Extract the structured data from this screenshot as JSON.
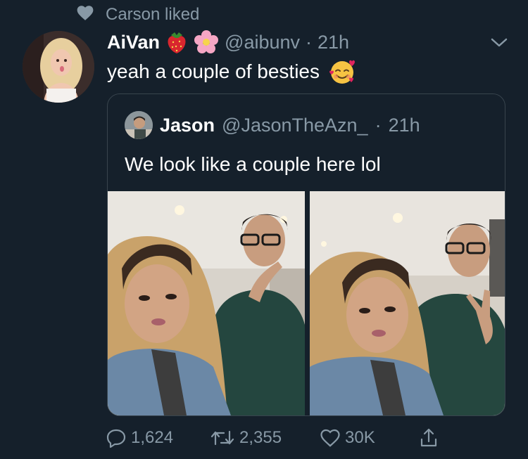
{
  "social_context": {
    "icon": "heart-icon",
    "text": "Carson liked"
  },
  "tweet": {
    "display_name": "AiVan",
    "name_emojis": [
      "strawberry-icon",
      "cherry-blossom-icon"
    ],
    "handle": "@aibunv",
    "separator": "·",
    "time": "21h",
    "text": "yeah a couple of besties",
    "text_emoji": "smiling-face-with-hearts-icon"
  },
  "quote": {
    "display_name": "Jason",
    "handle": "@JasonTheAzn_",
    "separator": "·",
    "time": "21h",
    "text": "We look like a couple here lol"
  },
  "actions": {
    "reply_count": "1,624",
    "retweet_count": "2,355",
    "like_count": "30K"
  },
  "colors": {
    "background": "#15202b",
    "muted": "#8899a6",
    "border": "#38444d"
  }
}
